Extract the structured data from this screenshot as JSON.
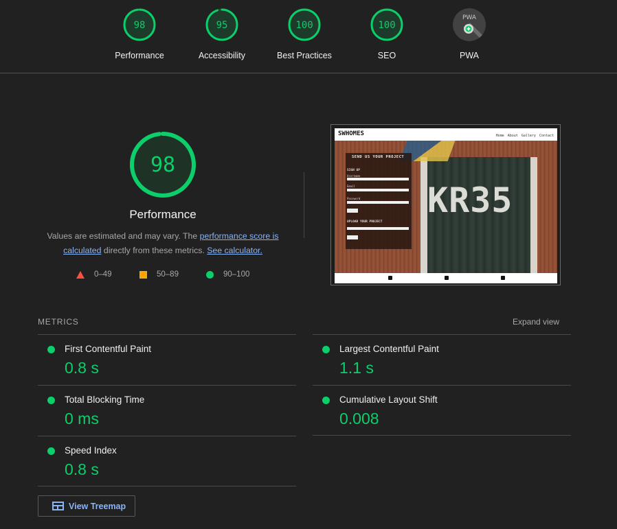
{
  "categories": [
    {
      "name": "Performance",
      "score": "98",
      "value": 98
    },
    {
      "name": "Accessibility",
      "score": "95",
      "value": 95
    },
    {
      "name": "Best Practices",
      "score": "100",
      "value": 100
    },
    {
      "name": "SEO",
      "score": "100",
      "value": 100
    },
    {
      "name": "PWA",
      "badge": "PWA"
    }
  ],
  "performance": {
    "score": "98",
    "value": 98,
    "title": "Performance",
    "desc_prefix": "Values are estimated and may vary. The ",
    "desc_link1": "performance score is calculated",
    "desc_middle": " directly from these metrics. ",
    "desc_link2": "See calculator."
  },
  "legend": {
    "fail": "0–49",
    "average": "50–89",
    "pass": "90–100"
  },
  "thumbnail": {
    "logo": "SWHOMES",
    "nav": "Home About Gallery Contact",
    "hero_text": "KR35",
    "form_title": "SEND US YOUR PROJECT",
    "form_section1": "SIGN UP",
    "form_label1": "Username",
    "form_label2": "Email",
    "form_label3": "Password",
    "form_section2": "UPLOAD YOUR PROJECT"
  },
  "metrics_header": {
    "title": "METRICS",
    "expand": "Expand view"
  },
  "metrics": [
    {
      "name": "First Contentful Paint",
      "value": "0.8 s"
    },
    {
      "name": "Largest Contentful Paint",
      "value": "1.1 s"
    },
    {
      "name": "Total Blocking Time",
      "value": "0 ms"
    },
    {
      "name": "Cumulative Layout Shift",
      "value": "0.008"
    },
    {
      "name": "Speed Index",
      "value": "0.8 s"
    }
  ],
  "treemap": {
    "label": "View Treemap"
  },
  "colors": {
    "pass": "#0cce6b",
    "average": "#ffa400",
    "fail": "#ff4e42",
    "link": "#8ab4f8"
  }
}
